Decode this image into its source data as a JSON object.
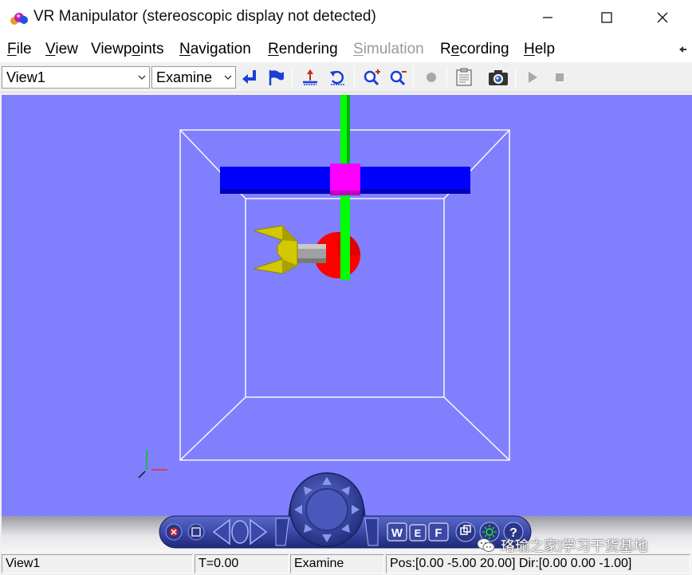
{
  "window": {
    "title": "VR Manipulator (stereoscopic display not detected)",
    "icon": "vr-app-icon",
    "controls": [
      "minimize-icon",
      "maximize-icon",
      "close-icon"
    ]
  },
  "menu": {
    "items": [
      {
        "label": "File",
        "accel": "F",
        "rest": "ile",
        "disabled": false
      },
      {
        "label": "View",
        "accel": "V",
        "rest": "iew",
        "disabled": false
      },
      {
        "label": "Viewpoints",
        "pre": "Viewp",
        "accel": "o",
        "rest": "ints",
        "disabled": false
      },
      {
        "label": "Navigation",
        "accel": "N",
        "rest": "avigation",
        "disabled": false
      },
      {
        "label": "Rendering",
        "accel": "R",
        "rest": "endering",
        "disabled": false
      },
      {
        "label": "Simulation",
        "accel": "S",
        "rest": "imulation",
        "disabled": true
      },
      {
        "label": "Recording",
        "pre": "R",
        "accel": "e",
        "rest": "cording",
        "disabled": false
      },
      {
        "label": "Help",
        "accel": "H",
        "rest": "elp",
        "disabled": false
      }
    ]
  },
  "toolbar": {
    "viewpoint_value": "View1",
    "nav_mode_value": "Examine",
    "buttons": [
      "return-to-viewpoint-icon",
      "create-viewpoint-icon",
      "straighten-up-icon",
      "undo-move-icon",
      "zoom-in-icon",
      "zoom-out-icon",
      "record-icon",
      "capture-settings-icon",
      "snapshot-icon",
      "play-icon",
      "stop-icon"
    ]
  },
  "scene": {
    "background": "#8080ff",
    "frame_color": "#ffffff",
    "rail_color": "#0000ff",
    "joint_color": "#ff00ff",
    "rod_color": "#00ff00",
    "ball_color": "#ff0000",
    "arm_color": "#a0a0a0",
    "gripper_color": "#d4c800"
  },
  "navpanel": {
    "buttons": [
      "close-nav-icon",
      "minimize-nav-icon",
      "rotate-left-icon",
      "rotate-right-icon",
      "direction-pad",
      "wireframe-button",
      "edges-button",
      "faces-button",
      "headlight-icon",
      "help-icon"
    ],
    "w_label": "W",
    "e_label": "E",
    "f_label": "F",
    "help_label": "?"
  },
  "status": {
    "viewpoint": "View1",
    "time": "T=0.00",
    "mode": "Examine",
    "pos_dir": "Pos:[0.00 -5.00 20.00] Dir:[0.00 0.00 -1.00]"
  },
  "watermark": {
    "text": "珞瑜之家|学习干货基地"
  }
}
